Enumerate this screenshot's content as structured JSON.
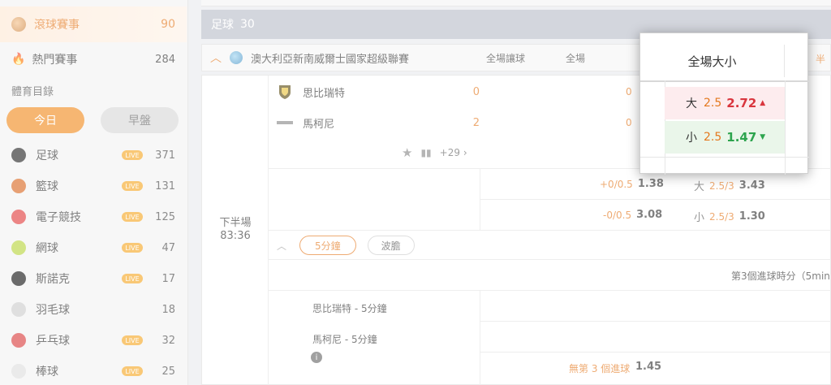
{
  "sidebar": {
    "live": {
      "label": "滾球賽事",
      "count": "90"
    },
    "hot": {
      "label": "熱門賽事",
      "count": "284"
    },
    "directory_label": "體育目錄",
    "today_label": "今日",
    "early_label": "早盤",
    "live_badge": "LIVE",
    "sports": [
      {
        "name": "足球",
        "count": "371",
        "live": true,
        "color": "#222"
      },
      {
        "name": "籃球",
        "count": "131",
        "live": true,
        "color": "#d9661f"
      },
      {
        "name": "電子競技",
        "count": "125",
        "live": true,
        "color": "#e03a3a"
      },
      {
        "name": "網球",
        "count": "47",
        "live": true,
        "color": "#b6d43a"
      },
      {
        "name": "斯諾克",
        "count": "17",
        "live": true,
        "color": "#111"
      },
      {
        "name": "羽毛球",
        "count": "18",
        "live": false,
        "color": "#ccc"
      },
      {
        "name": "乒乓球",
        "count": "32",
        "live": true,
        "color": "#d93a3a"
      },
      {
        "name": "棒球",
        "count": "25",
        "live": true,
        "color": "#ddd"
      }
    ]
  },
  "main": {
    "category": {
      "label": "足球",
      "count": "30"
    },
    "league": {
      "name": "澳大利亞新南威爾士國家超級聯賽",
      "col_handicap": "全場讓球",
      "col_total_short": "全場",
      "half_label": "半"
    },
    "match": {
      "period": "下半場",
      "clock": "83:36",
      "home": {
        "name": "思比瑞特",
        "score": "0",
        "score2": "0"
      },
      "away": {
        "name": "馬柯尼",
        "score": "2",
        "score2": "0"
      },
      "more_markets": "+29",
      "odds": {
        "home_hc": "+0/0.5",
        "home_val": "1.38",
        "away_hc": "-0/0.5",
        "away_val": "3.08",
        "over_pre": "大",
        "over_hc": "2.5/3",
        "over_val": "3.43",
        "under_pre": "小",
        "under_hc": "2.5/3",
        "under_val": "1.30"
      },
      "tab_5min": "5分鐘",
      "tab_corners": "波膽",
      "goal3_label": "第3個進球時分（5min",
      "home_5min": "思比瑞特 - 5分鐘",
      "away_5min": "馬柯尼 - 5分鐘",
      "info_icon": "i",
      "no_goal_label": "無第 3 個進球",
      "no_goal_val": "1.45"
    }
  },
  "popup": {
    "title": "全場大小",
    "over": {
      "pre": "大",
      "hc": "2.5",
      "val": "2.72",
      "dir": "up"
    },
    "under": {
      "pre": "小",
      "hc": "2.5",
      "val": "1.47",
      "dir": "down"
    }
  }
}
